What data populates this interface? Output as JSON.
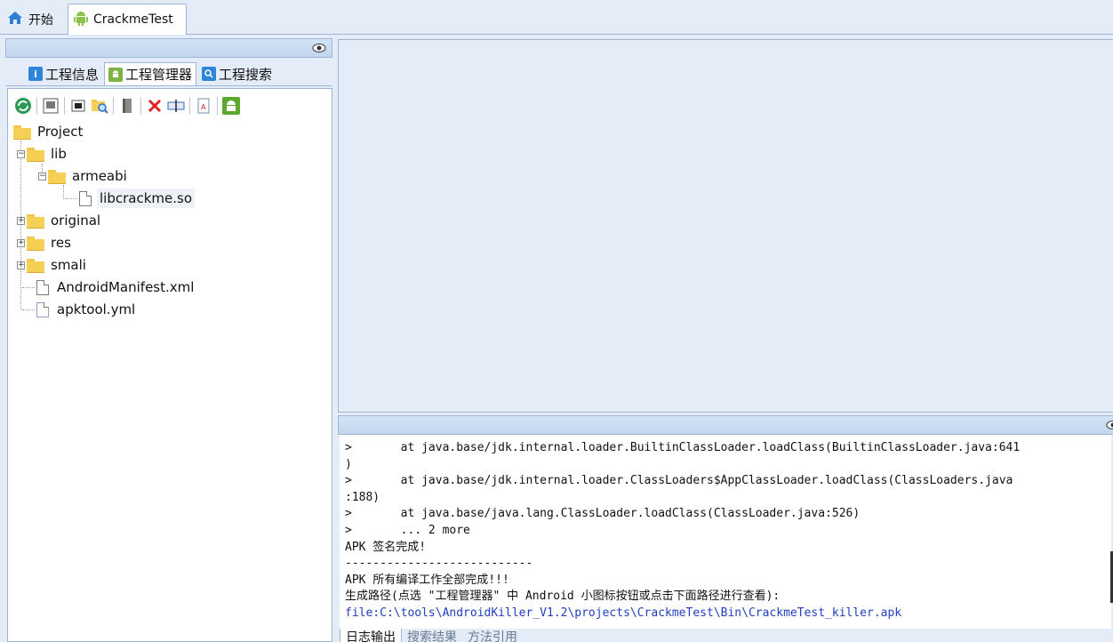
{
  "doc_tabs": {
    "home_label": "开始",
    "project_label": "CrackmeTest"
  },
  "left_panel": {
    "sub_tabs": [
      {
        "label": "工程信息",
        "icon": "info-icon"
      },
      {
        "label": "工程管理器",
        "icon": "android-icon"
      },
      {
        "label": "工程搜索",
        "icon": "search-icon"
      }
    ],
    "toolbar_icons": [
      "refresh-icon",
      "image-icon",
      "window-icon",
      "folder-search-icon",
      "book-icon",
      "delete-icon",
      "rename-icon",
      "text-file-icon",
      "android-icon"
    ],
    "tree": {
      "root": "Project",
      "lib": "lib",
      "armeabi": "armeabi",
      "so_file": "libcrackme.so",
      "original": "original",
      "res": "res",
      "smali": "smali",
      "manifest": "AndroidManifest.xml",
      "apktool": "apktool.yml"
    }
  },
  "log": {
    "lines": [
      ">       at java.base/jdk.internal.loader.BuiltinClassLoader.loadClass(BuiltinClassLoader.java:641",
      ")",
      ">       at java.base/jdk.internal.loader.ClassLoaders$AppClassLoader.loadClass(ClassLoaders.java",
      ":188)",
      ">       at java.base/java.lang.ClassLoader.loadClass(ClassLoader.java:526)",
      ">       ... 2 more",
      "APK 签名完成!",
      "---------------------------",
      "APK 所有编译工作全部完成!!!",
      "生成路径(点选 \"工程管理器\" 中 Android 小图标按钮或点击下面路径进行查看):"
    ],
    "link": "file:C:\\tools\\AndroidKiller_V1.2\\projects\\CrackmeTest\\Bin\\CrackmeTest_killer.apk"
  },
  "bottom_tabs": [
    "日志输出",
    "搜索结果",
    "方法引用"
  ],
  "colors": {
    "background": "#e3ecf7",
    "border": "#9fb7d6",
    "link": "#2040c0",
    "folder": "#f6cf55"
  }
}
